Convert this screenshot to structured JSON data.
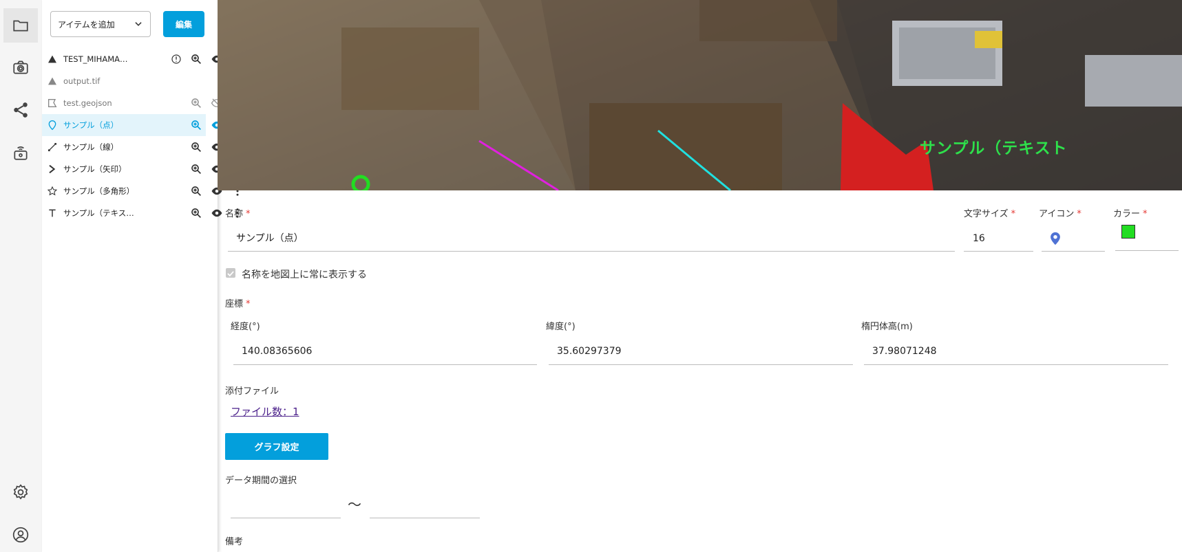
{
  "toolbar": {
    "add_item_label": "アイテムを追加",
    "edit_label": "編集"
  },
  "layers": [
    {
      "name": "TEST_MIHAMA…",
      "type_icon": "triangle-icon"
    },
    {
      "name": "output.tif",
      "type_icon": "triangle-icon"
    },
    {
      "name": "test.geojson",
      "type_icon": "polygon-icon"
    },
    {
      "name": "サンプル（点）",
      "type_icon": "pin-icon"
    },
    {
      "name": "サンプル（線）",
      "type_icon": "line-icon"
    },
    {
      "name": "サンプル（矢印）",
      "type_icon": "arrow-icon"
    },
    {
      "name": "サンプル（多角形）",
      "type_icon": "star-icon"
    },
    {
      "name": "サンプル（テキス…",
      "type_icon": "text-icon"
    }
  ],
  "map": {
    "label_text": "サンプル（テキスト"
  },
  "form": {
    "name_label": "名称",
    "required_mark": "*",
    "name_value": "サンプル（点）",
    "font_size_label": "文字サイズ",
    "font_size_value": "16",
    "icon_label": "アイコン",
    "color_label": "カラー",
    "color_value": "#22dd22",
    "always_show_label": "名称を地図上に常に表示する",
    "coords_label": "座標",
    "lon_label": "経度(°)",
    "lon_value": "140.08365606",
    "lat_label": "緯度(°)",
    "lat_value": "35.60297379",
    "height_label": "楕円体高(m)",
    "height_value": "37.98071248",
    "attach_label": "添付ファイル",
    "attach_link": "ファイル数：1",
    "graph_button": "グラフ設定",
    "period_label": "データ期間の選択",
    "period_sep": "〜",
    "notes_label": "備考"
  },
  "colors": {
    "accent": "#039fdc",
    "required": "#e53935"
  }
}
